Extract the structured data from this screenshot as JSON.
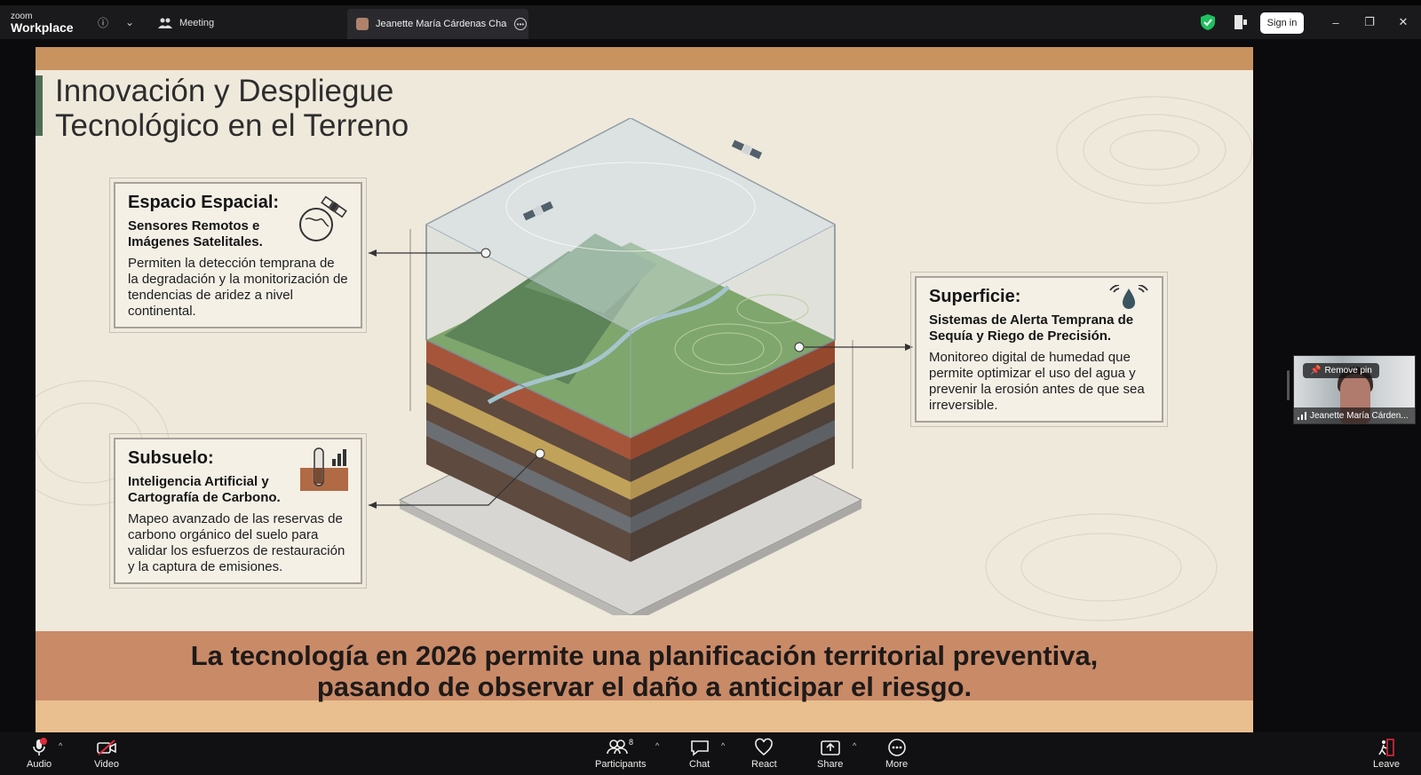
{
  "app": {
    "brand_small": "zoom",
    "brand_big": "Workplace"
  },
  "titlebar": {
    "meeting_label": "Meeting",
    "active_tab_label": "Jeanette María Cárdenas Chacón'",
    "sign_in_label": "Sign in",
    "info_icon": "ⓘ",
    "chevron_icon": "⌄",
    "minimize_icon": "–",
    "restore_icon": "❐",
    "close_icon": "✕"
  },
  "slide": {
    "title_line1": "Innovación y Despliegue",
    "title_line2": "Tecnológico en el Terreno",
    "cards": [
      {
        "heading": "Espacio Espacial:",
        "subheading": "Sensores Remotos e Imágenes Satelitales.",
        "body": "Permiten la detección temprana de la degradación y la monitorización de tendencias de aridez a nivel continental."
      },
      {
        "heading": "Superficie:",
        "subheading": "Sistemas de Alerta Temprana de Sequía y Riego de Precisión.",
        "body": "Monitoreo digital de humedad que permite optimizar el uso del agua y prevenir la erosión antes de que sea irreversible."
      },
      {
        "heading": "Subsuelo:",
        "subheading": "Inteligencia Artificial y Cartografía de Carbono.",
        "body": "Mapeo avanzado de las reservas de carbono orgánico del suelo para validar los esfuerzos de restauración y la captura de emisiones."
      }
    ],
    "footer_line1": "La tecnología en 2026 permite una planificación territorial preventiva,",
    "footer_line2": "pasando de observar el daño a anticipar el riesgo."
  },
  "participant_video": {
    "remove_pin_label": "Remove pin",
    "name": "Jeanette María Cárden..."
  },
  "toolbar": {
    "audio": "Audio",
    "video": "Video",
    "participants": "Participants",
    "participants_count": "8",
    "chat": "Chat",
    "react": "React",
    "share": "Share",
    "more": "More",
    "leave": "Leave"
  },
  "colors": {
    "slide_top_bar": "#c8935f",
    "slide_footer": "#c98a68",
    "slide_bg": "#efe9dc",
    "security_green": "#20c060",
    "audio_alert_red": "#e02a3a"
  }
}
